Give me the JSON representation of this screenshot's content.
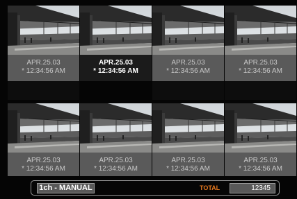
{
  "channels": [
    {
      "date": "APR.25.03",
      "time": "* 12:34:56 AM",
      "selected": false
    },
    {
      "date": "APR.25.03",
      "time": "* 12:34:56 AM",
      "selected": true
    },
    {
      "date": "APR.25.03",
      "time": "* 12:34:56 AM",
      "selected": false
    },
    {
      "date": "APR.25.03",
      "time": "* 12:34:56 AM",
      "selected": false
    },
    {
      "date": "APR.25.03",
      "time": "* 12:34:56 AM",
      "selected": false
    },
    {
      "date": "APR.25.03",
      "time": "* 12:34:56 AM",
      "selected": false
    },
    {
      "date": "APR.25.03",
      "time": "* 12:34:56 AM",
      "selected": false
    },
    {
      "date": "APR.25.03",
      "time": "* 12:34:56 AM",
      "selected": false
    }
  ],
  "status": {
    "mode": "1ch - MANUAL",
    "total_label": "TOTAL",
    "total_value": "12345"
  },
  "colors": {
    "accent": "#e8791e",
    "info_bg": "#5a5a5a"
  }
}
